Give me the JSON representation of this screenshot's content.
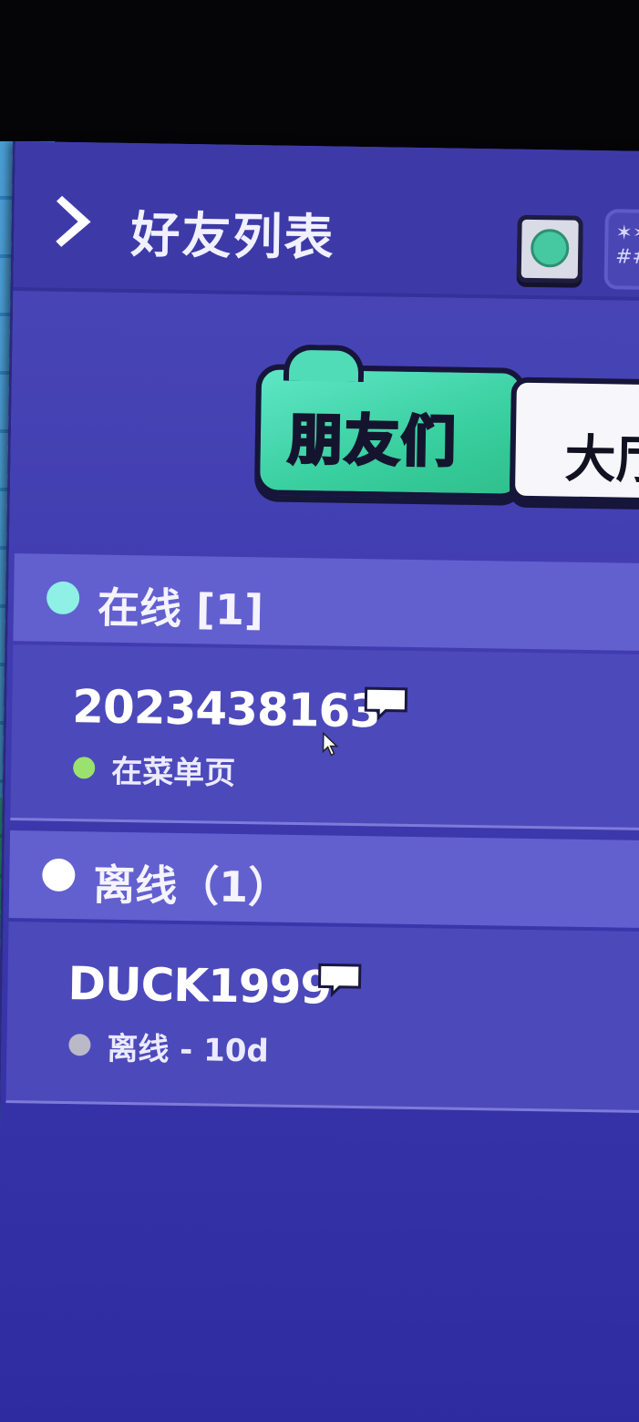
{
  "header": {
    "title": "好友列表",
    "settings_glyphs": "✶✶\n##"
  },
  "tabs": [
    {
      "label": "朋友们",
      "active": true
    },
    {
      "label": "大厅",
      "active": false
    }
  ],
  "sections": {
    "online": {
      "label": "在线 [1]",
      "color": "#8ff0e6"
    },
    "offline": {
      "label": "离线（1）",
      "color": "#ffffff"
    }
  },
  "friends": {
    "online": [
      {
        "name": "2023438163",
        "status": "在菜单页",
        "status_color": "#9ae26d"
      }
    ],
    "offline": [
      {
        "name": "DUCK1999",
        "status": "离线 - 10d",
        "status_color": "#b9b9c8"
      }
    ]
  },
  "colors": {
    "panel": "#3f3cb0",
    "active_tab": "#39cf9f",
    "section_header": "#6260cf"
  }
}
